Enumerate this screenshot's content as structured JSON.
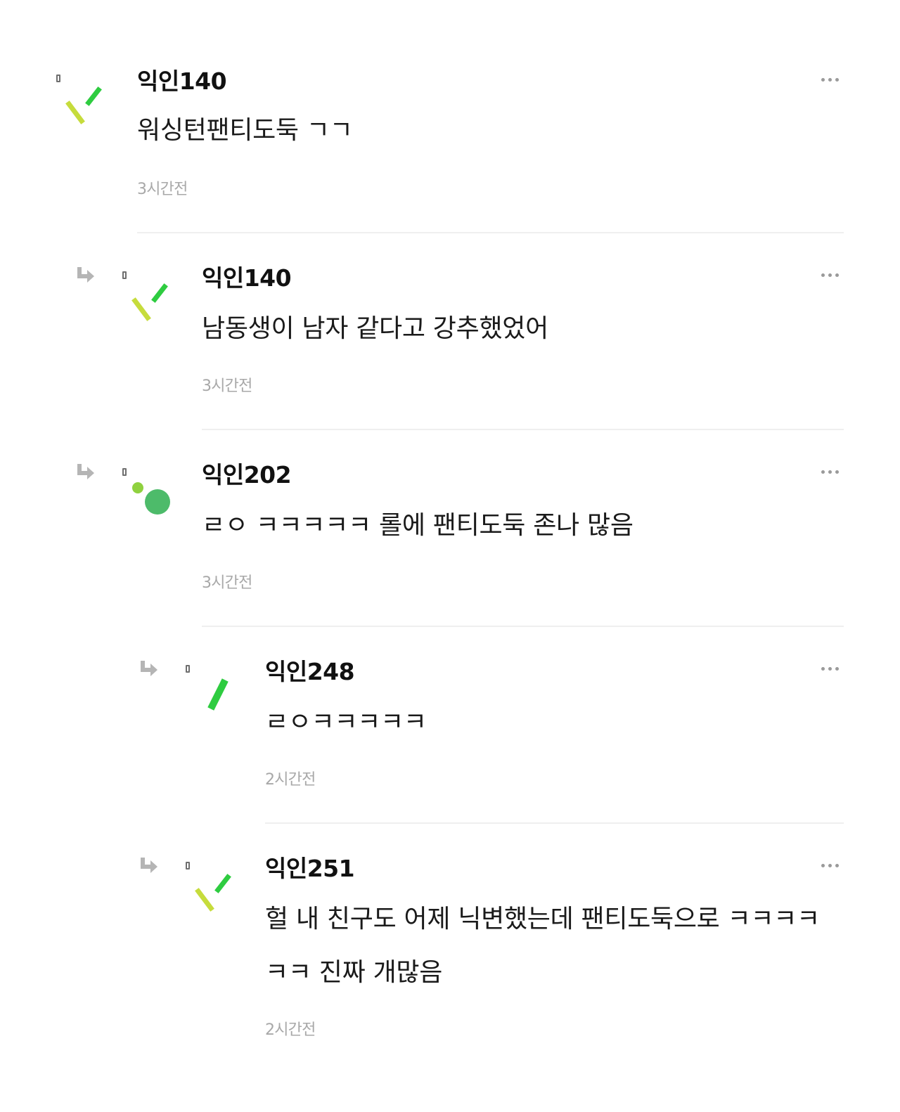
{
  "comments": [
    {
      "username": "익인140",
      "text": "워싱턴팬티도둑 ㄱㄱ",
      "time": "3시간전",
      "is_reply": false,
      "avatar_icon": "sprout-icon"
    },
    {
      "username": "익인140",
      "text": "남동생이 남자 같다고 강추했었어",
      "time": "3시간전",
      "is_reply": true,
      "avatar_icon": "sprout-icon"
    },
    {
      "username": "익인202",
      "text": "ㄹㅇ ㅋㅋㅋㅋㅋ 롤에 팬티도둑 존나 많음",
      "time": "3시간전",
      "is_reply": true,
      "avatar_icon": "dots-icon"
    },
    {
      "username": "익인248",
      "text": "ㄹㅇㅋㅋㅋㅋㅋ",
      "time": "2시간전",
      "is_reply": true,
      "avatar_icon": "stick-icon"
    },
    {
      "username": "익인251",
      "text": "헐 내 친구도 어제 닉변했는데 팬티도둑으로 ㅋㅋㅋㅋㅋㅋ 진짜 개많음",
      "time": "2시간전",
      "is_reply": true,
      "avatar_icon": "sprout-icon"
    }
  ],
  "colors": {
    "avatar_green": "#2ecc40",
    "avatar_lime": "#c6dc3c",
    "avatar_circle": "#4dbb6a",
    "avatar_dot": "#8fd13f",
    "time_gray": "#a8a8a8",
    "divider": "#efefef",
    "icon_gray": "#9a9a9a"
  },
  "icons": {
    "reply": "reply-arrow-icon",
    "more": "more-icon",
    "level": "level-badge-icon"
  }
}
